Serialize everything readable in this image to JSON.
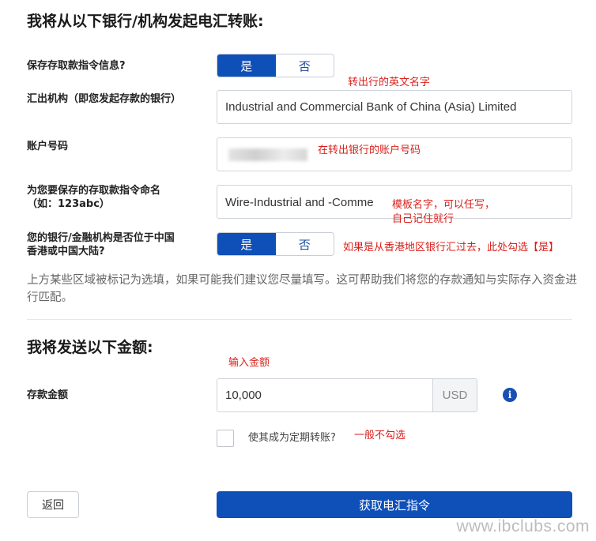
{
  "headings": {
    "from_bank": "我将从以下银行/机构发起电汇转账:",
    "amount": "我将发送以下金额:"
  },
  "save_instruction": {
    "label": "保存存取款指令信息?",
    "options": [
      "是",
      "否"
    ],
    "selected": "是"
  },
  "bank_name": {
    "label": "汇出机构（即您发起存款的银行）",
    "value": "Industrial and Commercial Bank of China (Asia) Limited"
  },
  "account_number": {
    "label": "账户号码",
    "value_redacted": true
  },
  "template_name": {
    "label_line1": "为您要保存的存取款指令命名",
    "label_line2": "（如：123abc）",
    "value": "Wire-Industrial and -Comme"
  },
  "hk_mainland": {
    "label_line1": "您的银行/金融机构是否位于中国",
    "label_line2": "香港或中国大陆?",
    "options": [
      "是",
      "否"
    ],
    "selected": "是"
  },
  "help_text": "上方某些区域被标记为选填，如果可能我们建议您尽量填写。这可帮助我们将您的存款通知与实际存入资金进行匹配。",
  "deposit": {
    "label": "存款金额",
    "value": "10,000",
    "currency": "USD"
  },
  "recurring": {
    "label": "使其成为定期转账?",
    "checked": false
  },
  "buttons": {
    "back": "返回",
    "submit": "获取电汇指令"
  },
  "annotations": {
    "bank_name_note": "转出行的英文名字",
    "account_note": "在转出银行的账户号码",
    "template_note_line1": "模板名字，可以任写，",
    "template_note_line2": "自己记住就行",
    "hk_note": "如果是从香港地区银行汇过去，此处勾选【是】",
    "amount_note": "输入金额",
    "recurring_note": "一般不勾选"
  },
  "watermark": "www.ibclubs.com",
  "colors": {
    "primary": "#0f4fb8",
    "annotation": "#d9211c"
  }
}
